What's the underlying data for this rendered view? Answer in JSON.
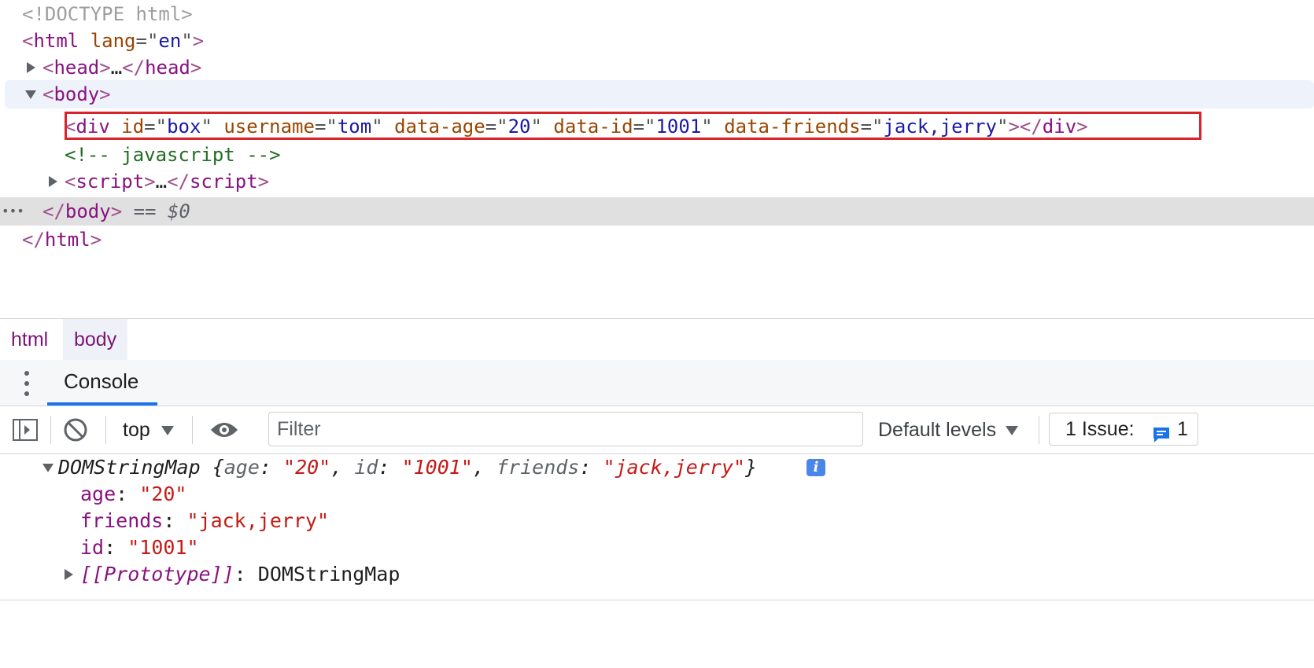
{
  "elements": {
    "doctype": "<!DOCTYPE html>",
    "html_open": {
      "tag": "html",
      "attr_name": "lang",
      "attr_value": "en"
    },
    "head": {
      "open": "head",
      "ellipsis": "…",
      "close": "head"
    },
    "body_open": "body",
    "div": {
      "tag": "div",
      "attrs": [
        {
          "name": "id",
          "value": "box"
        },
        {
          "name": "username",
          "value": "tom"
        },
        {
          "name": "data-age",
          "value": "20"
        },
        {
          "name": "data-id",
          "value": "1001"
        },
        {
          "name": "data-friends",
          "value": "jack,jerry"
        }
      ],
      "close": "div"
    },
    "comment": "<!-- javascript -->",
    "script": {
      "open": "script",
      "ellipsis": "…",
      "close": "script"
    },
    "body_close": "body",
    "selected_marker": "==",
    "selected_ref": "$0",
    "row_ellipsis": "•••",
    "html_close": "html"
  },
  "breadcrumb": [
    "html",
    "body"
  ],
  "drawer": {
    "tab_label": "Console"
  },
  "toolbar": {
    "context": "top",
    "filter_placeholder": "Filter",
    "levels": "Default levels",
    "issues_label": "1 Issue:",
    "issues_count": "1"
  },
  "console": {
    "object_header": {
      "type": "DOMStringMap",
      "preview": [
        {
          "key": "age",
          "value": "\"20\""
        },
        {
          "key": "id",
          "value": "\"1001\""
        },
        {
          "key": "friends",
          "value": "\"jack,jerry\""
        }
      ]
    },
    "props": [
      {
        "key": "age",
        "value": "\"20\""
      },
      {
        "key": "friends",
        "value": "\"jack,jerry\""
      },
      {
        "key": "id",
        "value": "\"1001\""
      }
    ],
    "prototype": {
      "key": "[[Prototype]]",
      "value": "DOMStringMap"
    },
    "info_badge": "i"
  },
  "colors": {
    "tag": "#881280",
    "attr_name": "#994500",
    "attr_value": "#1a1aa6",
    "comment": "#236e25",
    "highlight_border": "#d9232a",
    "accent": "#1a73e8",
    "string": "#c41a16"
  }
}
